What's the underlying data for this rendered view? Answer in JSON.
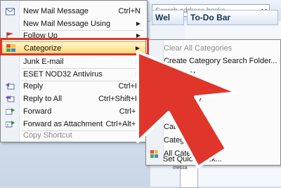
{
  "search": {
    "placeholder": "Search address books"
  },
  "background_panes": {
    "pane1_title": "Wel",
    "pane2_title": "To-Do Bar",
    "fragment_text": "messa"
  },
  "context_menu": {
    "items": [
      {
        "label": "New Mail Message",
        "shortcut": "Ctrl+N",
        "icon": "new-mail-icon"
      },
      {
        "label": "New Mail Message Using",
        "submenu": true,
        "icon": ""
      },
      {
        "label": "Follow Up",
        "submenu": true,
        "icon": "flag-icon"
      },
      {
        "label": "Categorize",
        "submenu": true,
        "icon": "categorize-icon",
        "highlighted": true
      },
      {
        "label": "Junk E-mail",
        "submenu": true,
        "icon": ""
      },
      {
        "label": "ESET NOD32 Antivirus",
        "submenu": true,
        "icon": ""
      },
      {
        "label": "Reply",
        "shortcut": "Ctrl+R",
        "icon": "reply-icon"
      },
      {
        "label": "Reply to All",
        "shortcut": "Ctrl+Shift+R",
        "icon": "reply-all-icon"
      },
      {
        "label": "Forward",
        "shortcut": "Ctrl+F",
        "icon": "forward-icon"
      },
      {
        "label": "Forward as Attachment",
        "shortcut": "Ctrl+Alt+F",
        "icon": "forward-attachment-icon"
      },
      {
        "label": "Copy Shortcut",
        "disabled": true,
        "icon": ""
      }
    ]
  },
  "submenu": {
    "items": [
      {
        "label": "Clear All Categories",
        "disabled": true
      },
      {
        "label": "Create Category Search Folder..."
      },
      {
        "label": "Category"
      },
      {
        "label": "egory"
      },
      {
        "label": "ory"
      },
      {
        "label": "ory"
      },
      {
        "label": "Category"
      },
      {
        "label": "Category"
      },
      {
        "label": "All Categories..."
      },
      {
        "label": "Set Quick Click..."
      }
    ]
  },
  "colors": {
    "highlight": "#ffdb7a",
    "annotation_red": "#e0352a"
  }
}
